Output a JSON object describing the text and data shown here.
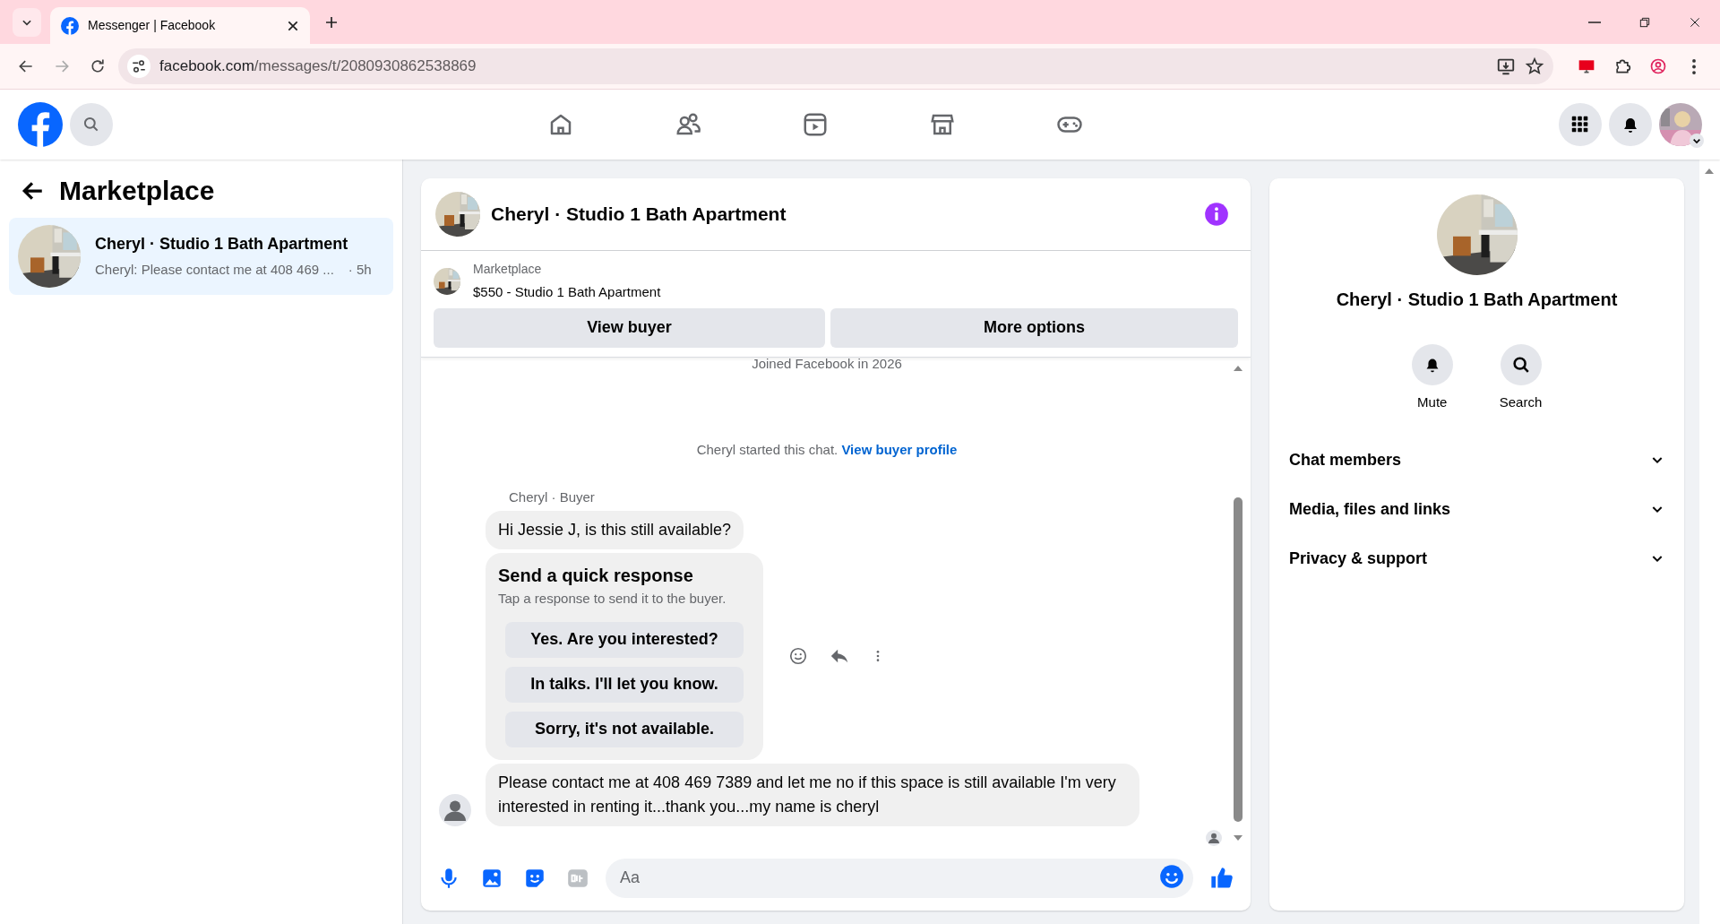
{
  "browser": {
    "tab_title": "Messenger | Facebook",
    "url_host": "facebook.com",
    "url_path": "/messages/t/2080930862538869"
  },
  "sidebar": {
    "title": "Marketplace",
    "threads": [
      {
        "title": "Cheryl · Studio 1 Bath Apartment",
        "preview": "Cheryl: Please contact me at 408 469 ...",
        "time": "· 5h",
        "selected": true
      }
    ]
  },
  "chat": {
    "title": "Cheryl · Studio 1 Bath Apartment",
    "listing": {
      "label": "Marketplace",
      "title": "$550 - Studio 1 Bath Apartment"
    },
    "buttons": [
      "View buyer",
      "More options"
    ],
    "joined_note": "Joined Facebook in 2026",
    "started_note": "Cheryl started this chat.",
    "started_link": "View buyer profile",
    "sender_label": "Cheryl · Buyer",
    "messages": [
      {
        "kind": "text",
        "text": "Hi Jessie J, is this still available?"
      },
      {
        "kind": "quick_response",
        "title": "Send a quick response",
        "subtitle": "Tap a response to send it to the buyer.",
        "options": [
          "Yes. Are you interested?",
          "In talks. I'll let you know.",
          "Sorry, it's not available."
        ]
      },
      {
        "kind": "text",
        "text": "Please contact me at 408 469 7389 and let me no if this space is still available I'm very interested in renting it...thank you...my name is cheryl"
      }
    ],
    "composer": {
      "placeholder": "Aa"
    }
  },
  "details": {
    "title": "Cheryl · Studio 1 Bath Apartment",
    "actions": [
      {
        "kind": "mute",
        "label": "Mute"
      },
      {
        "kind": "search",
        "label": "Search"
      }
    ],
    "sections": [
      {
        "label": "Chat members",
        "expanded": false
      },
      {
        "label": "Media, files and links",
        "expanded": false
      },
      {
        "label": "Privacy & support",
        "expanded": false
      }
    ]
  }
}
